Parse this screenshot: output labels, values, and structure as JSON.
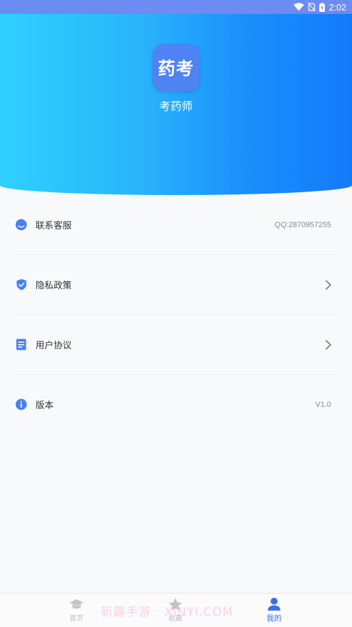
{
  "status_bar": {
    "time": "2:02"
  },
  "app": {
    "logo_text": "药考",
    "name": "考药师"
  },
  "menu": [
    {
      "label": "联系客服",
      "value": "QQ:2870957255",
      "icon": "chat-bubble-icon"
    },
    {
      "label": "隐私政策",
      "icon": "shield-check-icon",
      "chevron": true
    },
    {
      "label": "用户协议",
      "icon": "document-icon",
      "chevron": true
    },
    {
      "label": "版本",
      "value": "V1.0",
      "icon": "info-icon"
    }
  ],
  "tabs": [
    {
      "label": "首页",
      "icon": "graduation-cap-icon",
      "active": false
    },
    {
      "label": "收藏",
      "icon": "star-icon",
      "active": false
    },
    {
      "label": "我的",
      "icon": "user-icon",
      "active": true
    }
  ],
  "watermark": "新趣手游 · XINYI.COM",
  "colors": {
    "accent": "#3b6fe8",
    "icon": "#4a7ef2",
    "header_start": "#2fd0fe",
    "header_end": "#147af9"
  }
}
